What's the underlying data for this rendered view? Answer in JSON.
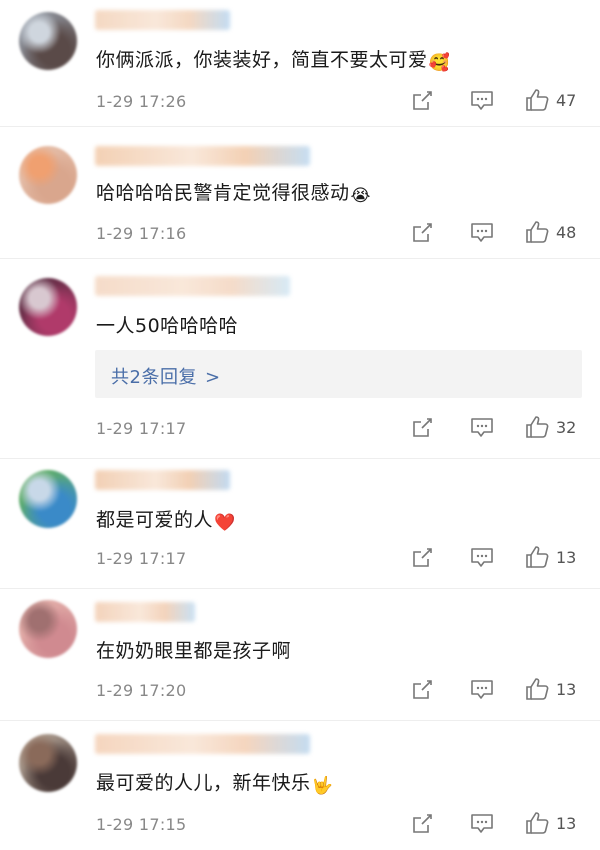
{
  "comments": [
    {
      "text": "你俩派派，你装装好，简直不要太可爱",
      "emoji": "🥰",
      "time": "1-29 17:26",
      "likes": "47",
      "avatar_colors": [
        "#5a4a48",
        "#9aa4b0",
        "#cfd6de"
      ],
      "name_colors": [
        "#f3d2b8",
        "#b9d6f0"
      ]
    },
    {
      "text": "哈哈哈哈民警肯定觉得很感动",
      "emoji": "😭",
      "time": "1-29 17:16",
      "likes": "48",
      "avatar_colors": [
        "#d9a68d",
        "#e8c4b0",
        "#f0a070"
      ],
      "name_colors": [
        "#f2c9a8",
        "#bcd8f0"
      ]
    },
    {
      "text": "一人50哈哈哈哈",
      "emoji": "",
      "time": "1-29 17:17",
      "likes": "32",
      "replies_label": "共2条回复",
      "replies_chevron": ">",
      "avatar_colors": [
        "#b03a6a",
        "#4a2a3a",
        "#d8c8d0"
      ],
      "name_colors": [
        "#f4d6c0",
        "#d0e6f4"
      ]
    },
    {
      "text": "都是可爱的人",
      "emoji": "❤️",
      "time": "1-29 17:17",
      "likes": "13",
      "avatar_colors": [
        "#3a8ac8",
        "#6ab84a",
        "#c8d8e8"
      ],
      "name_colors": [
        "#f0c8a8",
        "#b8d4ee"
      ]
    },
    {
      "text": "在奶奶眼里都是孩子啊",
      "emoji": "",
      "time": "1-29 17:20",
      "likes": "13",
      "avatar_colors": [
        "#d08a90",
        "#e8b8b0",
        "#a07070"
      ],
      "name_colors": [
        "#f2ccb0",
        "#c0dcf2"
      ]
    },
    {
      "text": "最可爱的人儿，新年快乐",
      "emoji": "🤟",
      "time": "1-29 17:15",
      "likes": "13",
      "avatar_colors": [
        "#4a3a38",
        "#c8b8a8",
        "#8a6a5a"
      ],
      "name_colors": [
        "#f4cfb4",
        "#bad6ee"
      ]
    }
  ],
  "icons": {
    "share": "share-icon",
    "comment": "comment-icon",
    "like": "like-icon"
  },
  "colors": {
    "link": "#4a6ea8",
    "timestamp": "#888888",
    "icon": "#777777"
  }
}
